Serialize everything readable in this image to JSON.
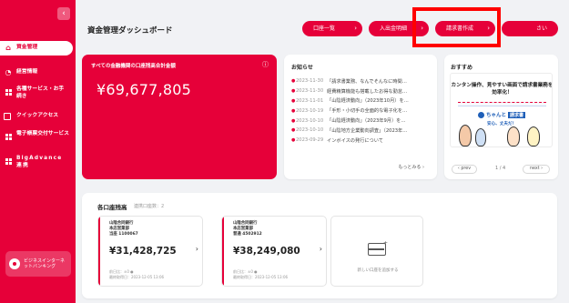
{
  "sidebar": {
    "collapse_icon": "chevron-left-icon",
    "items": [
      {
        "label": "資金管理",
        "icon": "home-icon"
      },
      {
        "label": "経営情報",
        "icon": "chart-icon"
      },
      {
        "label": "各種サービス・お手続き",
        "icon": "grid-icon"
      },
      {
        "label": "クイックアクセス",
        "icon": "square-icon"
      },
      {
        "label": "電子帳票交付サービス",
        "icon": "grid-icon"
      },
      {
        "label": "BigAdvance連携",
        "icon": "grid-icon"
      }
    ],
    "promo_label": "ビジネスインターネットバンキング"
  },
  "header": {
    "title": "資金管理ダッシュボード",
    "buttons": [
      {
        "label": "口座一覧"
      },
      {
        "label": "入出金明細"
      },
      {
        "label": "請求書作成"
      },
      {
        "label": "さい"
      }
    ]
  },
  "total": {
    "label": "すべての金融機関の口座残高合計金額",
    "amount": "¥69,677,805"
  },
  "notices": {
    "heading": "お知らせ",
    "items": [
      {
        "date": "2023-11-30",
        "text": "「請求書業務、なんでそんなに時間…"
      },
      {
        "date": "2023-11-30",
        "text": "経費精算機能も搭載したお得な勤怠…"
      },
      {
        "date": "2023-11-01",
        "text": "「山陰経済動向」（2023年10月）を…"
      },
      {
        "date": "2023-10-19",
        "text": "「手形・小切手の全面的な電子化を…"
      },
      {
        "date": "2023-10-10",
        "text": "「山陰経済動向」（2023年9月）を…"
      },
      {
        "date": "2023-10-10",
        "text": "「山陰地方企業動向調査」（2023年…"
      },
      {
        "date": "2023-09-29",
        "text": "インボイスの発行について"
      }
    ],
    "more": "もっとみる ›"
  },
  "recommend": {
    "heading": "おすすめ",
    "banner_title": "カンタン操作、見やすい画面で請求書業務を効率化！",
    "banner_logo": "ちゃんと",
    "banner_tag": "請求書",
    "banner_sub": "安心、丈夫だ！",
    "prev": "‹ prev",
    "page": "1 / 4",
    "next": "next ›"
  },
  "balances": {
    "heading": "各口座残高",
    "linked": "連携口座数：2",
    "accounts": [
      {
        "bank": "山陰合同銀行",
        "branch": "本店営業部",
        "number": "当座 1100067",
        "amount": "¥31,428,725",
        "prev": "前日比：±0 ●",
        "updated": "最終取得日：2023-12-05 13:06"
      },
      {
        "bank": "山陰合同銀行",
        "branch": "本店営業部",
        "number": "普通 4502912",
        "amount": "¥38,249,080",
        "prev": "前日比：±0 ●",
        "updated": "最終取得日：2023-12-05 13:06"
      }
    ],
    "add_label": "新しい口座を追加する"
  },
  "colors": {
    "accent": "#e60039",
    "highlight": "#ff0000"
  }
}
